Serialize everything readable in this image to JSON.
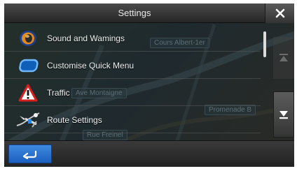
{
  "title": "Settings",
  "close_icon": "close-icon",
  "map_labels": [
    "Cours Albert-1er",
    "Ave Montaigne",
    "Promenade B",
    "Rue Freinel"
  ],
  "items": [
    {
      "label": "Sound and Wamings",
      "icon": "speaker-icon"
    },
    {
      "label": "Customise Quick Menu",
      "icon": "quick-menu-icon"
    },
    {
      "label": "Traffic",
      "icon": "warning-triangle-icon"
    },
    {
      "label": "Route Settings",
      "icon": "route-icon"
    }
  ],
  "scroll_up_icon": "scroll-top-icon",
  "scroll_down_icon": "scroll-bottom-icon",
  "back_icon": "back-arrow-icon",
  "colors": {
    "accent_blue": "#2a73d4",
    "background": "#1b1b1b"
  }
}
